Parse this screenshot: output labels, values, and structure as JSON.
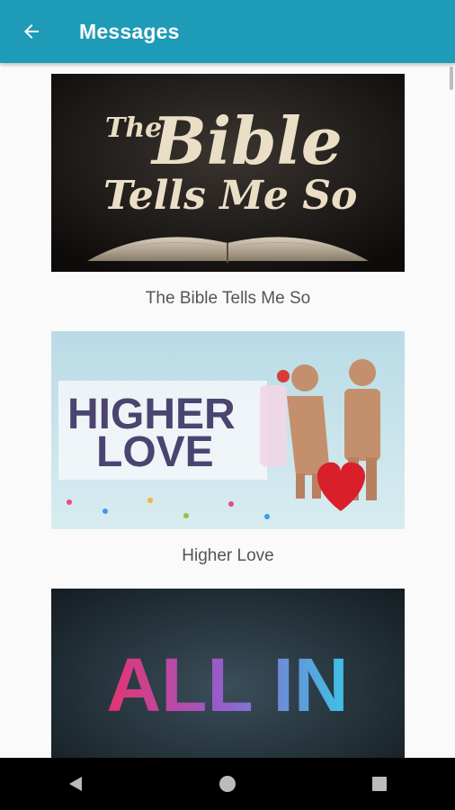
{
  "header": {
    "title": "Messages"
  },
  "messages": [
    {
      "title": "The Bible Tells Me So",
      "art": {
        "line1": "The",
        "line2": "Bible",
        "line3": "Tells Me So"
      }
    },
    {
      "title": "Higher Love",
      "art": {
        "line1": "HIGHER",
        "line2": "LOVE"
      }
    },
    {
      "title": "",
      "art": {
        "text": "ALL IN"
      }
    }
  ],
  "colors": {
    "appbar": "#1e9bb7",
    "background": "#fafafa",
    "caption": "#555555",
    "navbar": "#000000"
  },
  "icons": {
    "back": "arrow-left-icon",
    "nav_back": "triangle-back-icon",
    "nav_home": "circle-home-icon",
    "nav_recents": "square-recents-icon"
  }
}
